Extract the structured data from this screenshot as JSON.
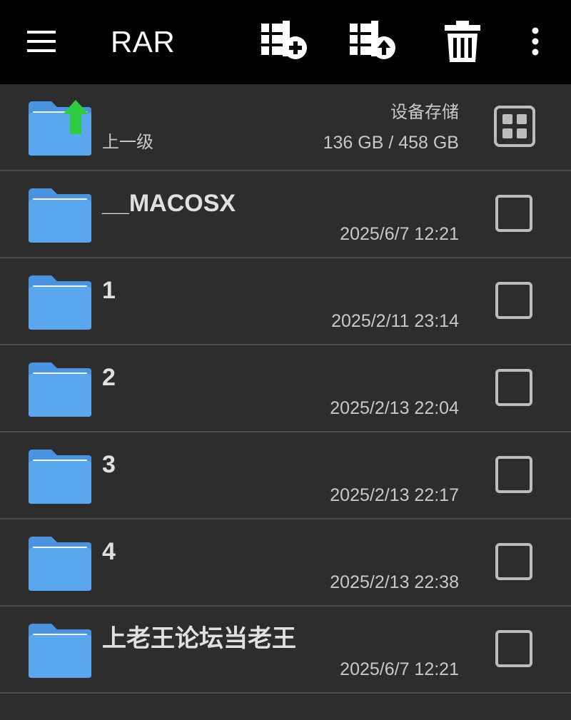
{
  "toolbar": {
    "title": "RAR",
    "icons": [
      "menu-icon",
      "add-to-archive-icon",
      "extract-archive-icon",
      "delete-icon",
      "more-vert-icon"
    ]
  },
  "parent": {
    "label": "上一级",
    "storage_name": "设备存储",
    "storage_size": "136 GB / 458 GB"
  },
  "items": [
    {
      "name": "__MACOSX",
      "date": "2025/6/7 12:21"
    },
    {
      "name": "1",
      "date": "2025/2/11 23:14"
    },
    {
      "name": "2",
      "date": "2025/2/13 22:04"
    },
    {
      "name": "3",
      "date": "2025/2/13 22:17"
    },
    {
      "name": "4",
      "date": "2025/2/13 22:38"
    },
    {
      "name": "上老王论坛当老王",
      "date": "2025/6/7 12:21"
    }
  ],
  "colors": {
    "toolbar_bg": "#000000",
    "list_bg": "#2d2d2d",
    "folder_blue": "#5aa7f0",
    "up_arrow_green": "#2ecc40",
    "divider": "#4a4a4a"
  }
}
